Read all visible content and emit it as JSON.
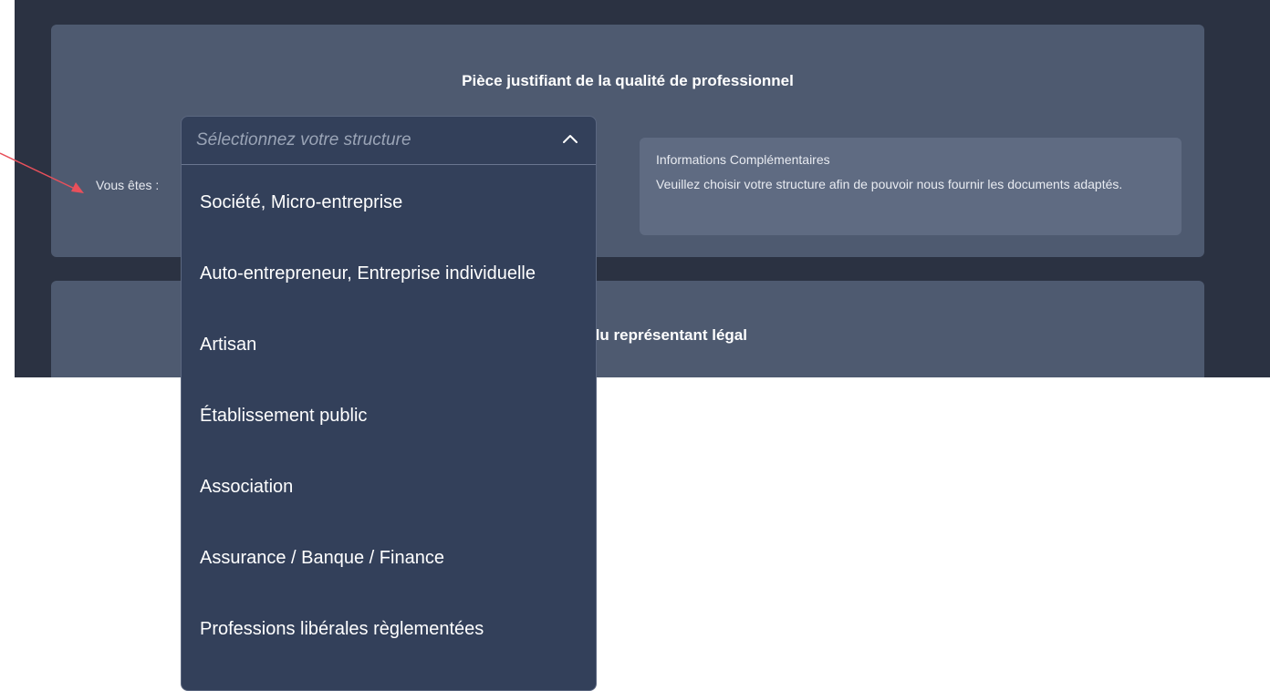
{
  "section1": {
    "title": "Pièce justifiant de la qualité de professionnel",
    "field_label": "Vous êtes :",
    "info": {
      "title": "Informations Complémentaires",
      "text": "Veuillez choisir votre structure afin de pouvoir nous fournir les documents adaptés."
    }
  },
  "section2": {
    "title_visible": "du représentant légal"
  },
  "dropdown": {
    "placeholder": "Sélectionnez votre structure",
    "expanded": true,
    "options": [
      "Société, Micro-entreprise",
      "Auto-entrepreneur, Entreprise individuelle",
      "Artisan",
      "Établissement public",
      "Association",
      "Assurance / Banque / Finance",
      "Professions libérales règlementées"
    ]
  },
  "icons": {
    "dropdown_toggle": "chevron-up-icon",
    "annotation": "arrow-icon"
  },
  "colors": {
    "page_bg": "#2b3242",
    "card_bg": "#4e5a70",
    "info_bg": "#5f6b82",
    "dropdown_bg": "#33405a",
    "annotation_arrow": "#e8505b"
  }
}
